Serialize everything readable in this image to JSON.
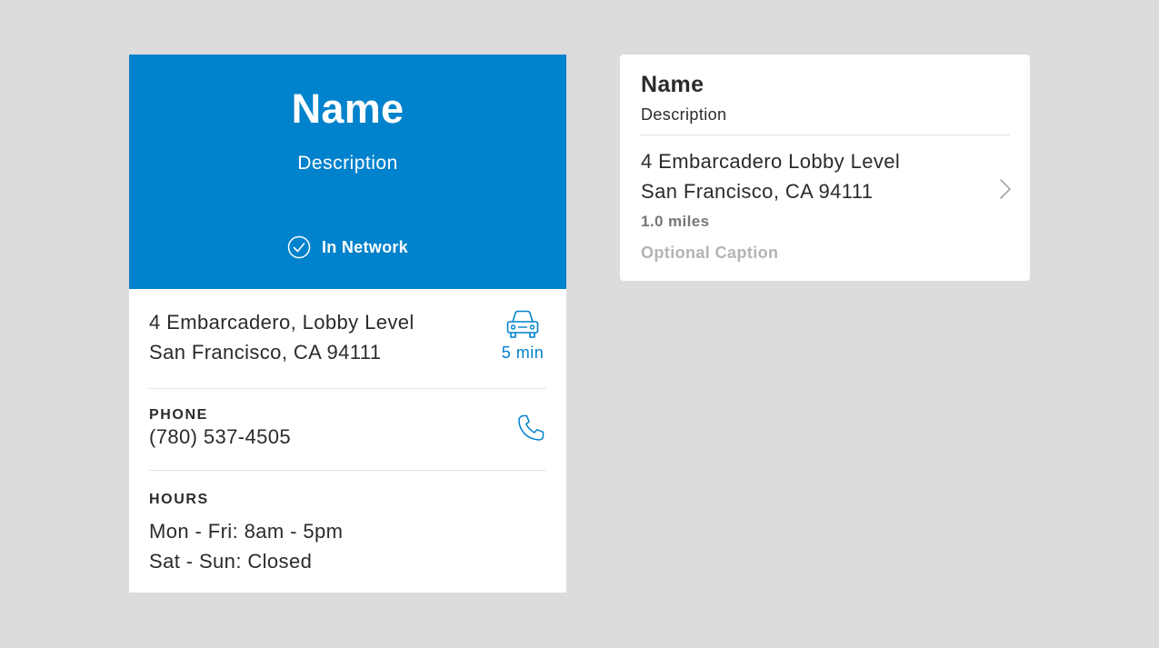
{
  "colors": {
    "brand_blue": "#0082cc",
    "background": "#dcdcdc",
    "card": "#ffffff",
    "text_primary": "#2b2b2b",
    "text_secondary": "#777777",
    "text_muted": "#b4b4b4"
  },
  "detail_card": {
    "header": {
      "name": "Name",
      "description": "Description",
      "network_icon": "check-circle-icon",
      "network_status": "In Network"
    },
    "address": {
      "line1": "4 Embarcadero, Lobby Level",
      "line2": "San Francisco, CA 94111",
      "travel_icon": "car-icon",
      "travel_time": "5 min"
    },
    "phone": {
      "label": "PHONE",
      "value": "(780) 537-4505",
      "icon": "phone-icon"
    },
    "hours": {
      "label": "HOURS",
      "lines": [
        "Mon - Fri: 8am - 5pm",
        "Sat - Sun: Closed"
      ]
    }
  },
  "summary_card": {
    "name": "Name",
    "description": "Description",
    "address_line1": "4 Embarcadero Lobby Level",
    "address_line2": "San Francisco, CA 94111",
    "distance": "1.0 miles",
    "caption": "Optional Caption",
    "chevron_icon": "chevron-right-icon"
  }
}
